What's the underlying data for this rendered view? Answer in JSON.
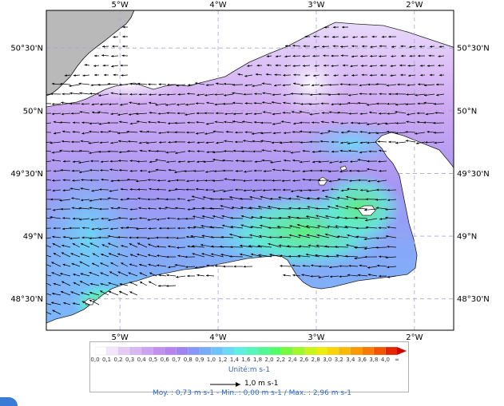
{
  "map": {
    "lon_ticks": [
      {
        "lon": -5,
        "label": "5°W"
      },
      {
        "lon": -4,
        "label": "4°W"
      },
      {
        "lon": -3,
        "label": "3°W"
      },
      {
        "lon": -2,
        "label": "2°W"
      }
    ],
    "lat_ticks": [
      {
        "lat": 50.5,
        "label": "50°30'N"
      },
      {
        "lat": 50.0,
        "label": "50°N"
      },
      {
        "lat": 49.5,
        "label": "49°30'N"
      },
      {
        "lat": 49.0,
        "label": "49°N"
      },
      {
        "lat": 48.5,
        "label": "48°30'N"
      }
    ],
    "extent": {
      "lon_min": -5.75,
      "lon_max": -1.6,
      "lat_min": 48.25,
      "lat_max": 50.8
    },
    "colors": {
      "land": "#b9b9b9",
      "grid": "#a8a8d0",
      "arrow": "#000000"
    }
  },
  "legend": {
    "ticks": [
      "0,0",
      "0,1",
      "0,2",
      "0,3",
      "0,4",
      "0,5",
      "0,6",
      "0,7",
      "0,8",
      "0,9",
      "1,0",
      "1,2",
      "1,4",
      "1,6",
      "1,8",
      "2,0",
      "2,2",
      "2,4",
      "2,6",
      "2,8",
      "3,0",
      "3,2",
      "3,4",
      "3,6",
      "3,8",
      "4,0",
      "∞"
    ],
    "colors": [
      "#ffffff",
      "#f1e6fb",
      "#e3cdf6",
      "#d7b8f3",
      "#cca3f0",
      "#c291ee",
      "#b584f0",
      "#9f84f4",
      "#8796f8",
      "#79abfb",
      "#6fc3fd",
      "#67dbf6",
      "#5fefe0",
      "#56f7be",
      "#4ff998",
      "#53fa6a",
      "#75fa3e",
      "#9ef82a",
      "#c8f51c",
      "#ecec11",
      "#fbd409",
      "#fbb904",
      "#fb9a02",
      "#f97a00",
      "#f25400",
      "#e12600",
      "#cf0000"
    ],
    "unit": "Unité:m s-1",
    "ref_arrow_label": "1,0 m s-1"
  },
  "stats": "Moy. : 0,73 m s-1   -   Min. : 0,00 m s-1 / Max. : 2,96 m s-1"
}
